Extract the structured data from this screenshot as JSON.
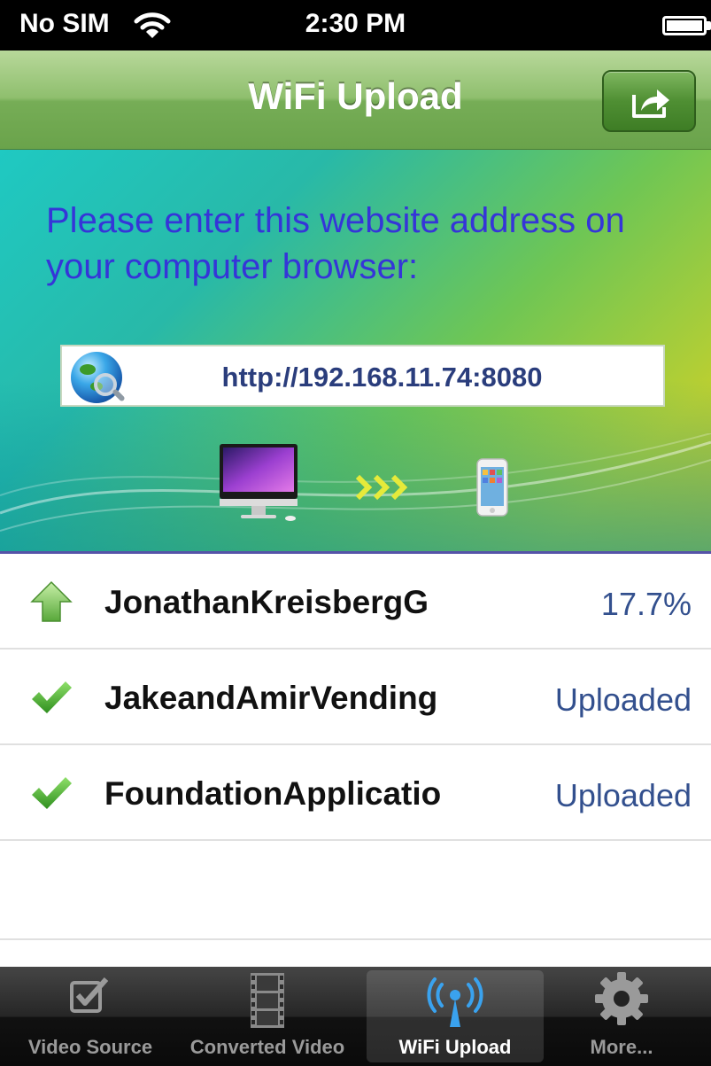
{
  "status_bar": {
    "carrier": "No SIM",
    "time": "2:30 PM"
  },
  "nav": {
    "title": "WiFi Upload",
    "share_icon": "share-icon"
  },
  "banner": {
    "instruction": "Please enter this website address on your computer browser:",
    "url": "http://192.168.11.74:8080",
    "icons": [
      "globe-search-icon",
      "computer-icon",
      "transfer-arrows-icon",
      "phone-icon"
    ]
  },
  "uploads": [
    {
      "name": "JonathanKreisbergG",
      "status": "17.7%",
      "icon": "upload-arrow-icon"
    },
    {
      "name": "JakeandAmirVending",
      "status": "Uploaded",
      "icon": "checkmark-icon"
    },
    {
      "name": "FoundationApplicatio",
      "status": "Uploaded",
      "icon": "checkmark-icon"
    }
  ],
  "tabs": [
    {
      "label": "Video Source",
      "icon": "checkbox-icon",
      "active": false
    },
    {
      "label": "Converted Video",
      "icon": "film-icon",
      "active": false
    },
    {
      "label": "WiFi Upload",
      "icon": "wifi-antenna-icon",
      "active": true
    },
    {
      "label": "More...",
      "icon": "gear-icon",
      "active": false
    }
  ],
  "colors": {
    "nav_green": "#76ad56",
    "instruction_blue": "#3535d8",
    "url_text": "#2a3d7c",
    "status_text": "#33508e"
  }
}
